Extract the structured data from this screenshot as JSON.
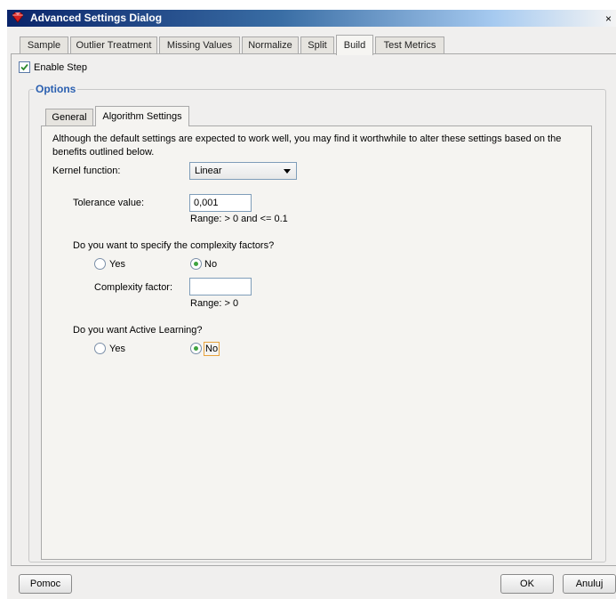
{
  "window": {
    "title": "Advanced Settings Dialog",
    "close_glyph": "×"
  },
  "tabs": [
    {
      "label": "Sample"
    },
    {
      "label": "Outlier Treatment"
    },
    {
      "label": "Missing Values"
    },
    {
      "label": "Normalize"
    },
    {
      "label": "Split"
    },
    {
      "label": "Build",
      "active": true
    },
    {
      "label": "Test Metrics"
    }
  ],
  "enable_step": {
    "label": "Enable Step",
    "checked": true
  },
  "options": {
    "legend": "Options"
  },
  "inner_tabs": [
    {
      "label": "General"
    },
    {
      "label": "Algorithm Settings",
      "active": true
    }
  ],
  "algorithm": {
    "description": "Although the default settings are expected to work well, you may find it worthwhile to alter these settings based on the benefits outlined below.",
    "kernel_label": "Kernel function:",
    "kernel_value": "Linear",
    "tolerance_label": "Tolerance value:",
    "tolerance_value": "0,001",
    "tolerance_range": "Range: > 0 and <= 0.1",
    "complexity_question": "Do you want to specify the complexity factors?",
    "complexity_yes": "Yes",
    "complexity_no": "No",
    "complexity_selected": "No",
    "complexity_factor_label": "Complexity factor:",
    "complexity_factor_value": "",
    "complexity_range": "Range: > 0",
    "active_learning_question": "Do you want Active Learning?",
    "active_yes": "Yes",
    "active_no": "No",
    "active_selected": "No"
  },
  "footer": {
    "help_label": "Pomoc",
    "ok_label": "OK",
    "cancel_label": "Anuluj"
  },
  "colors": {
    "title_gradient_start": "#0a246a",
    "legend": "#2a5fb0",
    "radio_selected": "#3fa33f",
    "focus_outline": "#e8a33c"
  }
}
